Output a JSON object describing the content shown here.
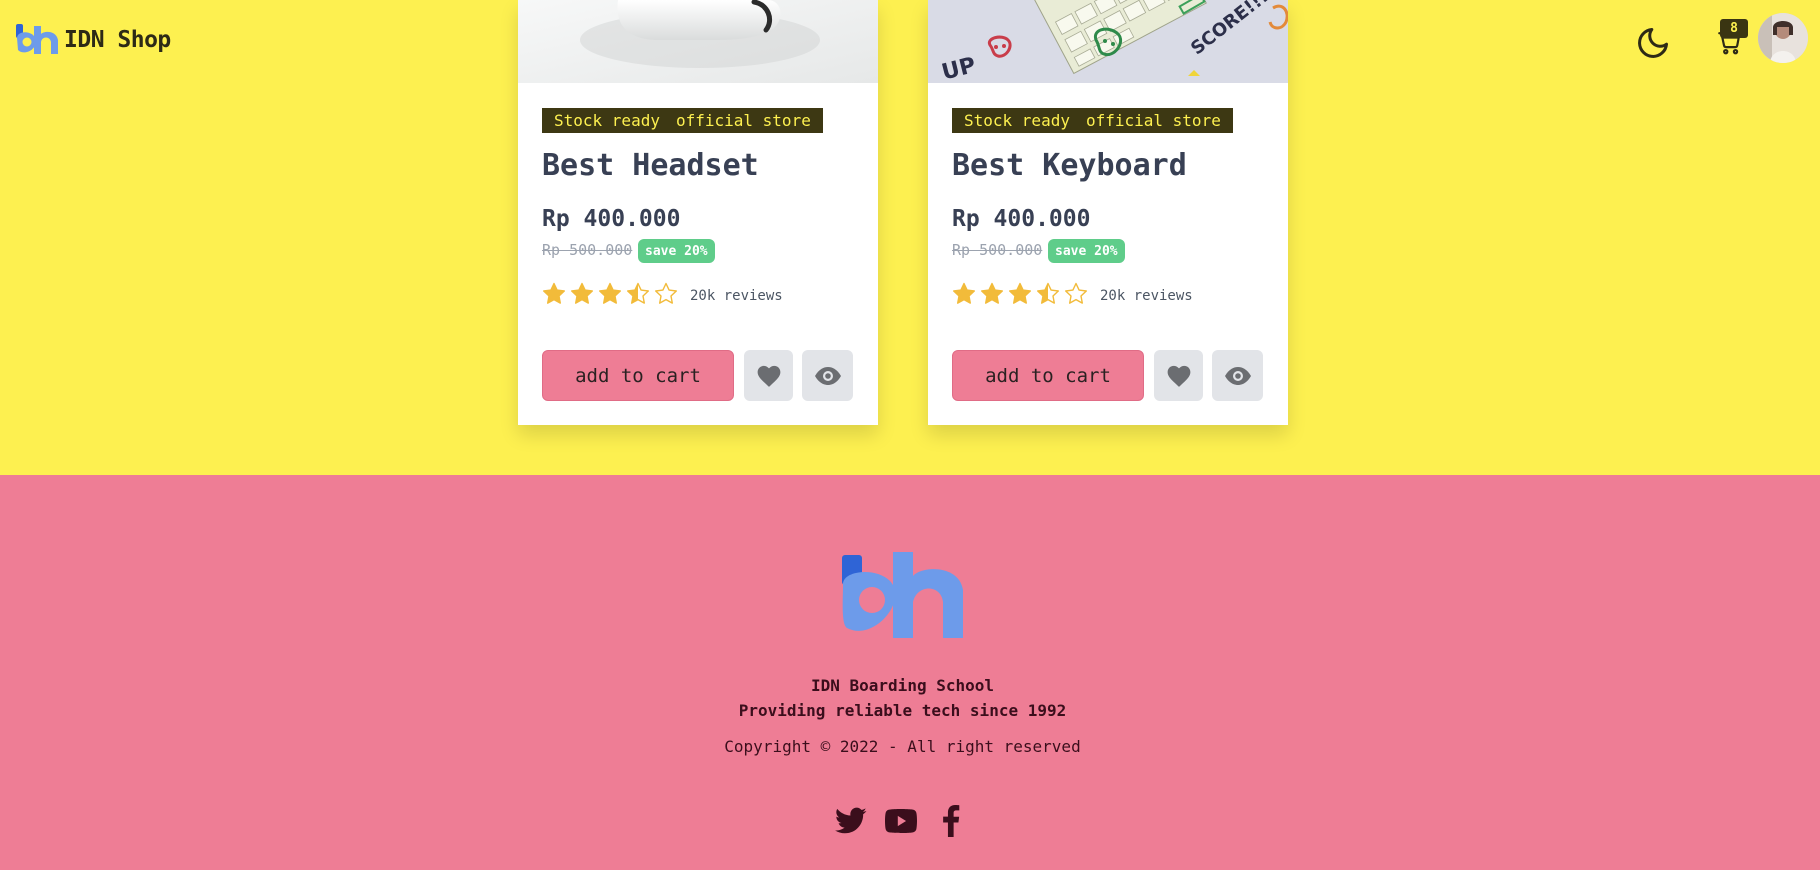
{
  "brand": {
    "name": "IDN Shop",
    "logo_icon": "idn-logo-icon"
  },
  "navbar": {
    "theme_icon": "moon-icon",
    "cart_icon": "cart-icon",
    "cart_count": "8"
  },
  "products": [
    {
      "image": "headset-photo",
      "tags": [
        "Stock ready",
        "official store"
      ],
      "title": "Best Headset",
      "price": "Rp 400.000",
      "old_price": "Rp 500.000",
      "save": "save 20%",
      "rating": 3.5,
      "rating_max": 5,
      "reviews": "20k reviews",
      "add_to_cart": "add to cart"
    },
    {
      "image": "keyboard-photo",
      "tags": [
        "Stock ready",
        "official store"
      ],
      "title": "Best Keyboard",
      "price": "Rp 400.000",
      "old_price": "Rp 500.000",
      "save": "save 20%",
      "rating": 3.5,
      "rating_max": 5,
      "reviews": "20k reviews",
      "add_to_cart": "add to cart"
    }
  ],
  "footer": {
    "school": "IDN Boarding School",
    "tagline": "Providing reliable tech since 1992",
    "copyright": "Copyright © 2022 - All right reserved",
    "socials": [
      "twitter-icon",
      "youtube-icon",
      "facebook-icon"
    ]
  },
  "colors": {
    "background": "#fdf050",
    "footer": "#ee7d95",
    "tag_bg": "#3d3813",
    "save_badge": "#5fcd8a",
    "star": "#f2bb3a",
    "logo": "#6d9bea"
  }
}
